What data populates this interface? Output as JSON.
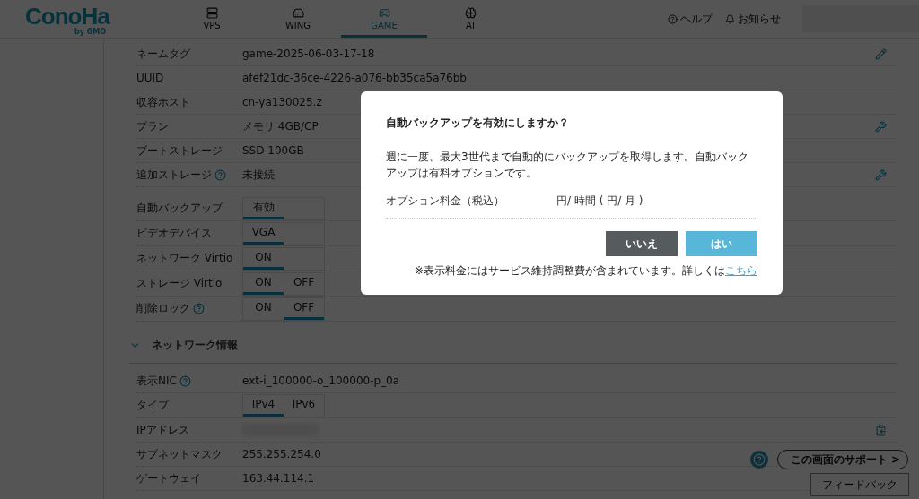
{
  "header": {
    "logo": {
      "name": "ConoHa",
      "sub": "by GMO"
    },
    "tabs": [
      {
        "label": "VPS",
        "selected": false
      },
      {
        "label": "WING",
        "selected": false
      },
      {
        "label": "GAME",
        "selected": true
      },
      {
        "label": "AI",
        "selected": false
      }
    ],
    "links": [
      "ヘルプ",
      "お知らせ"
    ]
  },
  "server_info": {
    "rows": [
      {
        "label": "ネームタグ",
        "kind": "text",
        "value": "game-2025-06-03-17-18"
      },
      {
        "label": "UUID",
        "kind": "text",
        "value": "afef21dc-36ce-4226-a076-bb35ca5a76bb"
      },
      {
        "label": "収容ホスト",
        "kind": "text",
        "value": "cn-ya130025.z"
      },
      {
        "label": "プラン",
        "kind": "text",
        "value": "メモリ 4GB/CP"
      },
      {
        "label": "ブートストレージ",
        "kind": "text",
        "value": "SSD 100GB"
      },
      {
        "label": "追加ストレージ",
        "help": true,
        "kind": "text",
        "value": "未接続"
      }
    ],
    "settings": [
      {
        "label": "自動バックアップ",
        "kind": "toggle",
        "options": [
          {
            "label": "有効",
            "selected": true
          }
        ]
      },
      {
        "label": "ビデオデバイス",
        "kind": "toggle",
        "options": [
          {
            "label": "VGA",
            "selected": true
          }
        ]
      },
      {
        "label": "ネットワーク Virtio",
        "kind": "toggle",
        "options": [
          {
            "label": "ON",
            "selected": true
          }
        ]
      },
      {
        "label": "ストレージ Virtio",
        "kind": "toggle",
        "options": [
          {
            "label": "ON",
            "selected": true
          },
          {
            "label": "OFF",
            "selected": false
          }
        ]
      },
      {
        "label": "削除ロック",
        "help": true,
        "kind": "toggle",
        "options": [
          {
            "label": "ON",
            "selected": false
          },
          {
            "label": "OFF",
            "selected": true
          }
        ]
      }
    ]
  },
  "network_section": {
    "title": "ネットワーク情報",
    "expanded": true,
    "rows": [
      {
        "label": "表示NIC",
        "help": true,
        "kind": "text",
        "value": "ext-i_100000-o_100000-p_0a"
      },
      {
        "label": "タイプ",
        "kind": "toggle",
        "options": [
          {
            "label": "IPv4",
            "selected": true
          },
          {
            "label": "IPv6",
            "selected": false
          }
        ]
      },
      {
        "label": "IPアドレス",
        "kind": "hidden"
      },
      {
        "label": "サブネットマスク",
        "kind": "text",
        "value": "255.255.254.0"
      },
      {
        "label": "ゲートウェイ",
        "kind": "text",
        "value": "163.44.114.1"
      }
    ]
  },
  "support_button": {
    "label": "この画面のサポート",
    "arrow": ">"
  },
  "feedback_button": {
    "label": "フィードバック"
  },
  "modal": {
    "title": "自動バックアップを有効にしますか？",
    "body": "週に一度、最大3世代まで自動的にバックアップを取得します。自動バックアップは有料オプションです。",
    "fee_label": "オプション料金（税込）",
    "fee_value": "円/ 時間 ( 円/ 月 )",
    "buttons": [
      {
        "label": "いいえ",
        "kind": "cancel"
      },
      {
        "label": "はい",
        "kind": "confirm"
      }
    ],
    "note": {
      "text": "※表示料金にはサービス維持調整費が含まれています。詳しくは",
      "link": "こちら"
    }
  }
}
